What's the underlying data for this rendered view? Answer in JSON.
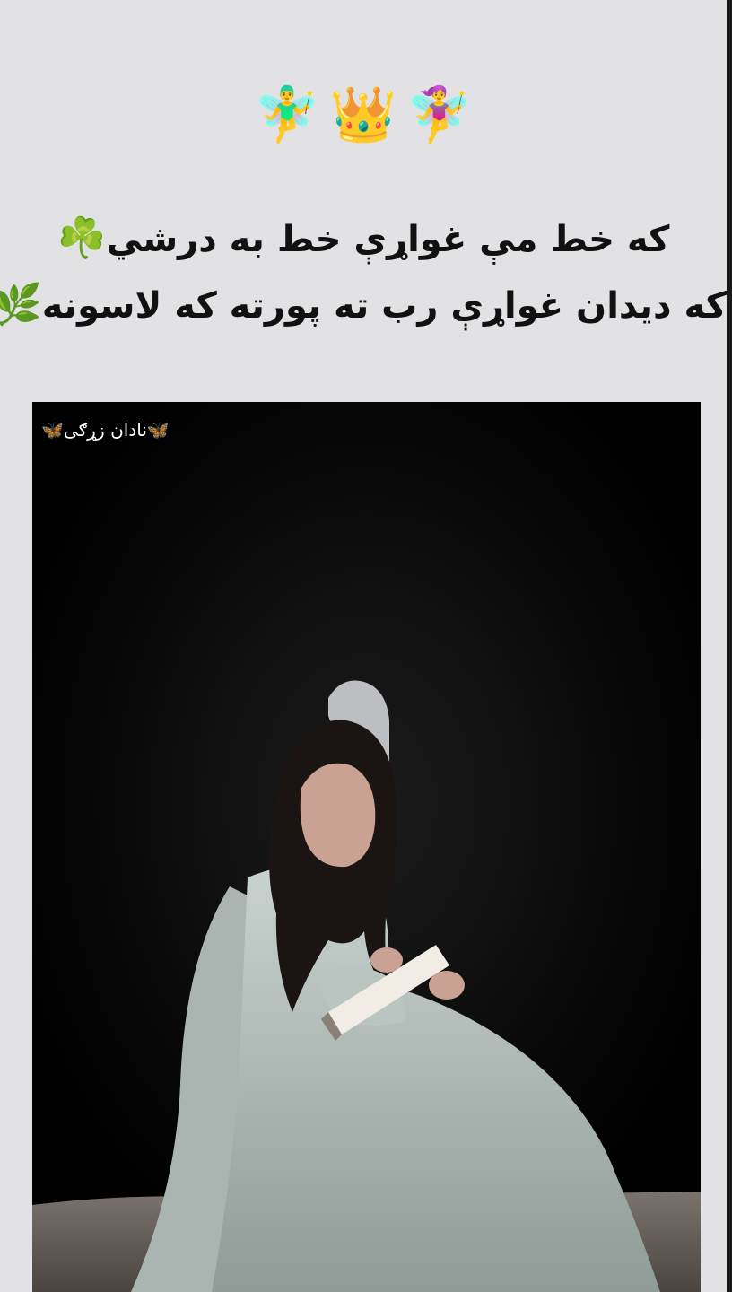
{
  "header": {
    "emojis": [
      "🧚‍♂️",
      "👑",
      "🧚‍♀️"
    ]
  },
  "poem": {
    "line1": "که خط مې غواړې خط به درشي",
    "line1_emoji": "☘️",
    "line2": "که دیدان غواړې رب ته پورته که لاسونه",
    "line2_emoji": "🌿"
  },
  "video": {
    "watermark": "🦋نادان زړګی🦋"
  },
  "colors": {
    "page_background": "#e2e2e4",
    "video_background": "#000000",
    "text": "#111111",
    "dress": "#b9c5c1"
  }
}
